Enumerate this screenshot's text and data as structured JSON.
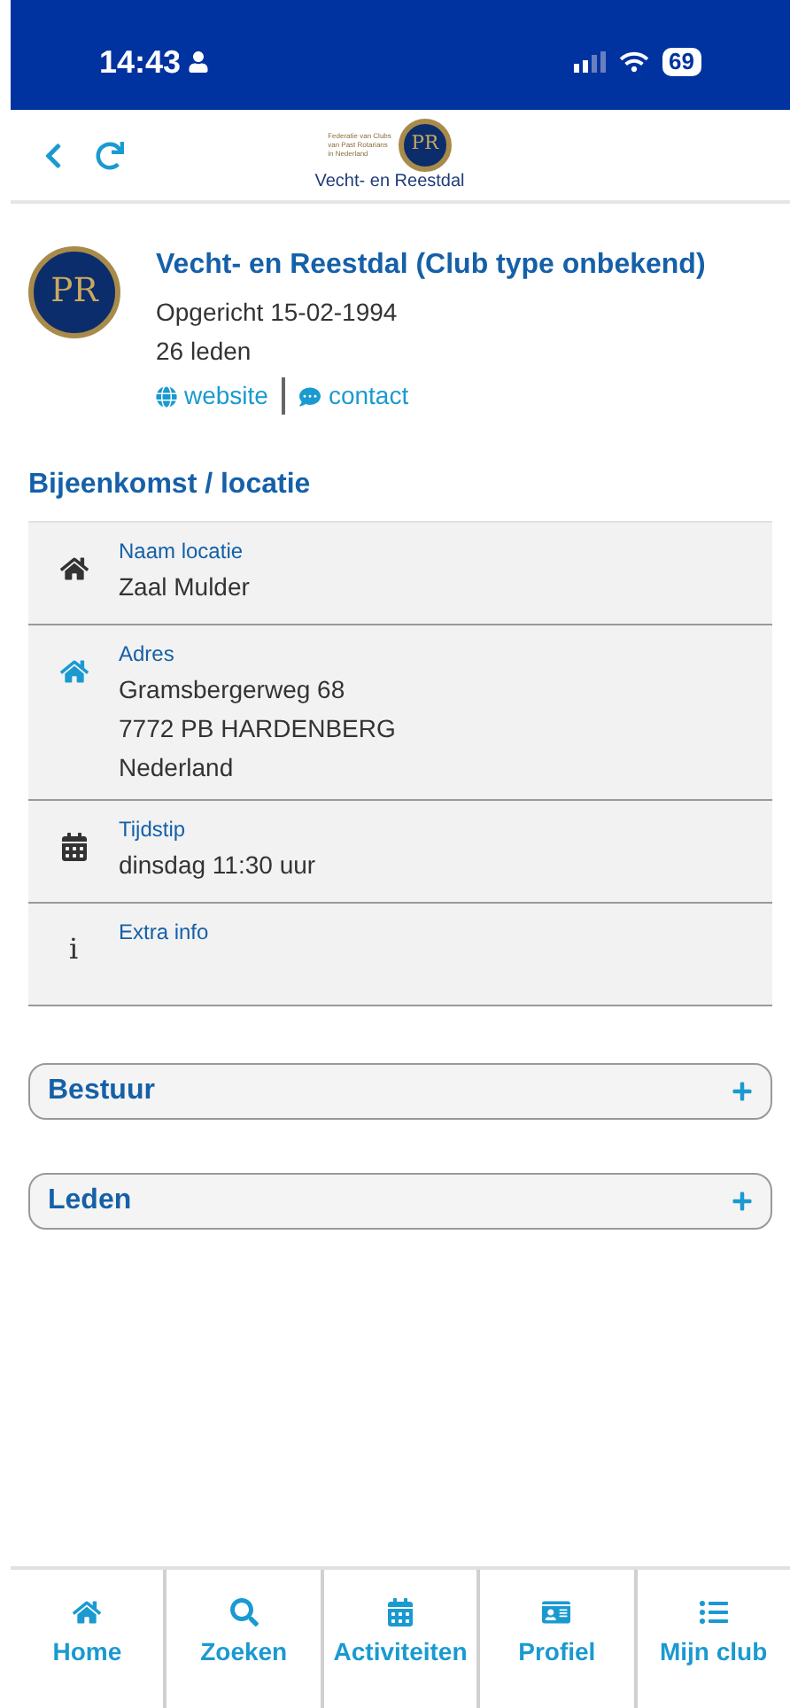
{
  "status_bar": {
    "time": "14:43",
    "battery": "69"
  },
  "header": {
    "logo_text": [
      "Federatie van Clubs",
      "van Past Rotarians",
      "in Nederland"
    ],
    "logo_initials": "PR",
    "subtitle": "Vecht- en Reestdal"
  },
  "club": {
    "initials": "PR",
    "name": "Vecht- en Reestdal (Club type onbekend)",
    "founded": "Opgericht 15-02-1994",
    "members": "26 leden",
    "links": [
      {
        "kind": "globe",
        "label": "website"
      },
      {
        "kind": "chat",
        "label": "contact"
      }
    ]
  },
  "section_title": "Bijeenkomst / locatie",
  "details": [
    {
      "kind": "home-dark",
      "label": "Naam locatie",
      "lines": [
        "Zaal Mulder"
      ]
    },
    {
      "kind": "home",
      "label": "Adres",
      "lines": [
        "Gramsbergerweg 68",
        "7772 PB HARDENBERG",
        "Nederland"
      ]
    },
    {
      "kind": "calendar",
      "label": "Tijdstip",
      "lines": [
        "dinsdag 11:30 uur"
      ]
    },
    {
      "kind": "info",
      "label": "Extra info",
      "info_glyph": "i"
    }
  ],
  "accordions": [
    {
      "title": "Bestuur",
      "expanded": false
    },
    {
      "title": "Leden",
      "expanded": false
    }
  ],
  "tabs": [
    {
      "kind": "home",
      "label": "Home"
    },
    {
      "kind": "search",
      "label": "Zoeken"
    },
    {
      "kind": "calendar",
      "label": "Activiteiten"
    },
    {
      "kind": "card",
      "label": "Profiel"
    },
    {
      "kind": "list",
      "label": "Mijn club"
    }
  ]
}
